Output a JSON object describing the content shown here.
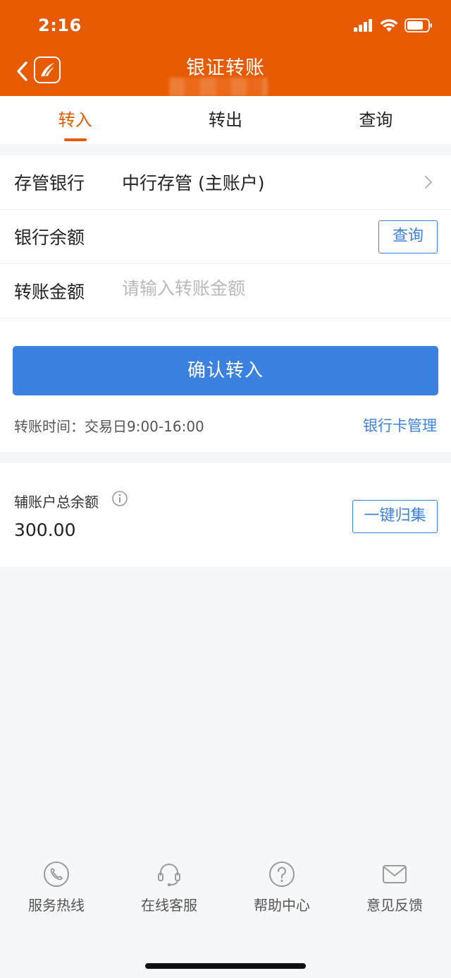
{
  "status_bar": {
    "time": "2:16"
  },
  "header": {
    "title": "银证转账"
  },
  "tabs": [
    {
      "label": "转入",
      "active": true
    },
    {
      "label": "转出",
      "active": false
    },
    {
      "label": "查询",
      "active": false
    }
  ],
  "form": {
    "bank_label": "存管银行",
    "bank_value": "中行存管 (主账户)",
    "balance_label": "银行余额",
    "balance_query_button": "查询",
    "amount_label": "转账金额",
    "amount_placeholder": "请输入转账金额",
    "confirm_button": "确认转入",
    "time_note": "转账时间：交易日9:00-16:00",
    "bank_card_link": "银行卡管理"
  },
  "sub_account": {
    "label": "辅账户总余额",
    "amount": "300.00",
    "collect_button": "一键归集"
  },
  "bottom_nav": [
    {
      "label": "服务热线",
      "icon": "phone-icon"
    },
    {
      "label": "在线客服",
      "icon": "headset-icon"
    },
    {
      "label": "帮助中心",
      "icon": "help-icon"
    },
    {
      "label": "意见反馈",
      "icon": "mail-icon"
    }
  ],
  "colors": {
    "brand": "#e85a00",
    "primary_blue": "#3b82e0",
    "background": "#f6f7f9"
  }
}
